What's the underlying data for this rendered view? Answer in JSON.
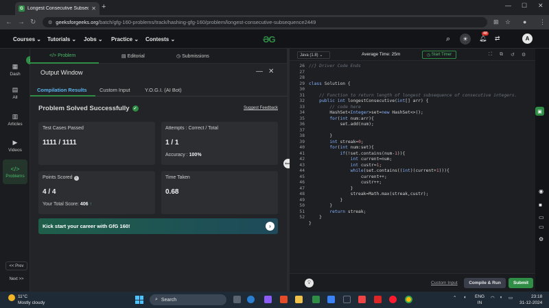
{
  "browser": {
    "tab_title": "Longest Consecutive Subseque",
    "url_host": "geeksforgeeks.org",
    "url_path": "/batch/gfg-160-problems/track/hashing-gfg-160/problem/longest-consecutive-subsequence2449"
  },
  "gfg_nav": {
    "items": [
      "Courses",
      "Tutorials",
      "Jobs",
      "Practice",
      "Contests"
    ],
    "logo_text": "GG",
    "notification_count": "48",
    "avatar_letter": "A"
  },
  "sidenav": {
    "items": [
      "Dash",
      "All",
      "Articles",
      "Videos",
      "Problems"
    ],
    "prev_label": "<< Prev",
    "next_label": "Next >>"
  },
  "problem_tabs": [
    "Problem",
    "Editorial",
    "Submissions"
  ],
  "output_window": {
    "title": "Output Window",
    "tabs": [
      "Compilation Results",
      "Custom Input",
      "Y.O.G.I. (AI Bot)"
    ],
    "status": "Problem Solved Successfully",
    "feedback_link": "Suggest Feedback",
    "test_cases_label": "Test Cases Passed",
    "test_cases_value": "1111 / 1111",
    "attempts_label": "Attempts : Correct / Total",
    "attempts_value": "1 / 1",
    "accuracy_label": "Accuracy :",
    "accuracy_value": "100%",
    "points_label": "Points Scored",
    "points_value": "4 / 4",
    "total_score_label": "Your Total Score:",
    "total_score_value": "406",
    "time_label": "Time Taken",
    "time_value": "0.68",
    "banner_text": "Kick start your career with GfG 160!"
  },
  "editor": {
    "language": "Java (1.8)",
    "avg_time": "Average Time: 25m",
    "timer_label": "Start Timer",
    "custom_input": "Custom Input",
    "compile_label": "Compile & Run",
    "submit_label": "Submit",
    "lines": [
      {
        "n": "26",
        "html": "<span class='cm'>//} Driver Code Ends</span>"
      },
      {
        "n": "27",
        "html": ""
      },
      {
        "n": "28",
        "html": ""
      },
      {
        "n": "29",
        "html": "<span class='kw'>class</span> Solution {"
      },
      {
        "n": "30",
        "html": ""
      },
      {
        "n": "31",
        "html": "    <span class='cm'>// Function to return length of longest subsequence of consecutive integers.</span>"
      },
      {
        "n": "32",
        "html": "    <span class='kw'>public int</span> longestConsecutive(<span class='kw'>int</span>[] arr) {"
      },
      {
        "n": "33",
        "html": "        <span class='cm'>// code here</span>"
      },
      {
        "n": "34",
        "html": "        HashSet&lt;<span class='ty'>Integer</span>&gt;set=<span class='kw'>new</span> HashSet&lt;&gt;();"
      },
      {
        "n": "35",
        "html": "        <span class='kw'>for</span>(<span class='kw'>int</span> num:arr){"
      },
      {
        "n": "36",
        "html": "            set.add(num);"
      },
      {
        "n": "37",
        "html": ""
      },
      {
        "n": "38",
        "html": "        }"
      },
      {
        "n": "39",
        "html": "        <span class='kw'>int</span> streak=<span class='nm'>0</span>;"
      },
      {
        "n": "40",
        "html": "        <span class='kw'>for</span>(<span class='kw'>int</span> num:set){"
      },
      {
        "n": "41",
        "html": "            <span class='kw'>if</span>(!set.contains(num-<span class='nm'>1</span>)){"
      },
      {
        "n": "42",
        "html": "                <span class='kw'>int</span> current=num;"
      },
      {
        "n": "43",
        "html": "                <span class='kw'>int</span> custr=<span class='nm'>1</span>;"
      },
      {
        "n": "44",
        "html": "                <span class='kw'>while</span>(set.contains((<span class='kw'>int</span>)(current+<span class='nm'>1</span>))){"
      },
      {
        "n": "45",
        "html": "                    current++;"
      },
      {
        "n": "46",
        "html": "                    custr++;"
      },
      {
        "n": "47",
        "html": "                }"
      },
      {
        "n": "48",
        "html": "                streak=Math.max(streak,custr);"
      },
      {
        "n": "49",
        "html": "            }"
      },
      {
        "n": "50",
        "html": "        }"
      },
      {
        "n": "51",
        "html": "        <span class='kw'>return</span> streak;"
      },
      {
        "n": "52",
        "html": "    }"
      },
      {
        "n": "",
        "html": "}"
      }
    ]
  },
  "taskbar": {
    "weather_temp": "11°C",
    "weather_desc": "Mostly cloudy",
    "search_placeholder": "Search",
    "lang_top": "ENG",
    "lang_bottom": "IN",
    "time": "23:18",
    "date": "31-12-2024"
  },
  "colors": {
    "brand_green": "#2f8d46",
    "accent_blue": "#5ab4f0"
  }
}
